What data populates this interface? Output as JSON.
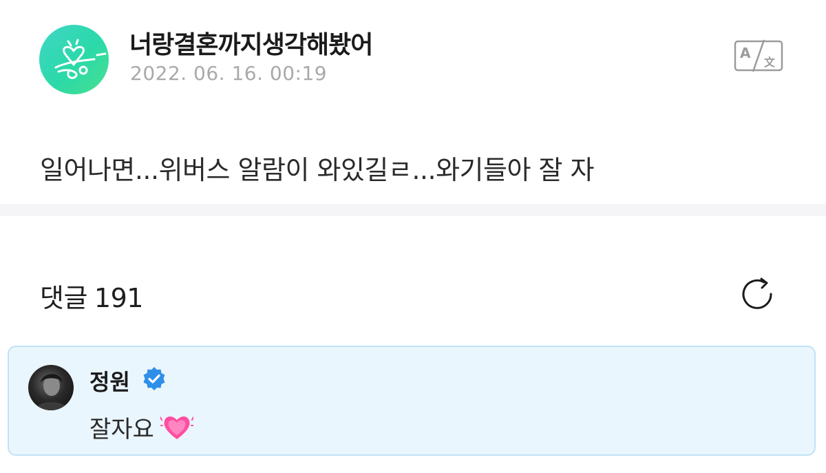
{
  "post": {
    "author": "너랑결혼까지생각해봤어",
    "date": "2022. 06. 16. 00:19",
    "text": "일어나면...위버스 알람이 와있길ㄹ...와기들아 잘 자",
    "translate_icon": "translate-icon"
  },
  "comments": {
    "label": "댓글",
    "count": "191",
    "refresh_icon": "refresh-icon",
    "items": [
      {
        "author": "정원",
        "verified": true,
        "text": "잘자요",
        "emoji_icon": "growing-heart-icon"
      }
    ]
  },
  "colors": {
    "avatar_gradient_start": "#3fd6c6",
    "avatar_gradient_end": "#49e08f",
    "date_gray": "#a9a9a9",
    "divider": "#f5f5f7",
    "comment_bg": "#eaf6fd",
    "comment_border": "#bfe3f5",
    "verified_blue": "#2f8fe8",
    "heart_pink": "#ff4fa0"
  }
}
